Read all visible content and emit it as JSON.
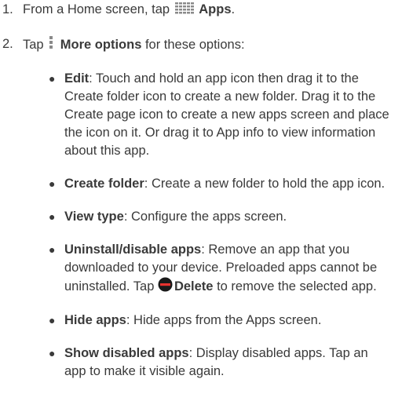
{
  "steps": [
    {
      "num": "1.",
      "prefix": "From a Home screen, tap",
      "icon": "apps-grid-icon",
      "bold": "Apps",
      "suffix": "."
    },
    {
      "num": "2.",
      "prefix": "Tap",
      "icon": "more-options-icon",
      "bold": "More options",
      "suffix": " for these options:"
    }
  ],
  "options": [
    {
      "term": "Edit",
      "desc": ": Touch and hold an app icon then drag it to the Create folder icon to create a new folder. Drag it to the Create page icon to create a new apps screen and place the icon on it. Or drag it to App info to view information about this app."
    },
    {
      "term": "Create folder",
      "desc": ": Create a new folder to hold the app icon."
    },
    {
      "term": "View type",
      "desc": ": Configure the apps screen."
    },
    {
      "term": "Uninstall/disable apps",
      "desc_before": ": Remove an app that you downloaded to your device. Preloaded apps cannot be uninstalled. Tap ",
      "icon": "delete-icon",
      "inline_bold": "Delete",
      "desc_after": " to remove the selected app."
    },
    {
      "term": "Hide apps",
      "desc": ": Hide apps from the Apps screen."
    },
    {
      "term": "Show disabled apps",
      "desc": ": Display disabled apps. Tap an app to make it visible again."
    }
  ],
  "bullet": "●",
  "colors": {
    "text": "#3a3a3a",
    "delete_icon": "#1a1a1a",
    "delete_bar": "#e8332f"
  }
}
